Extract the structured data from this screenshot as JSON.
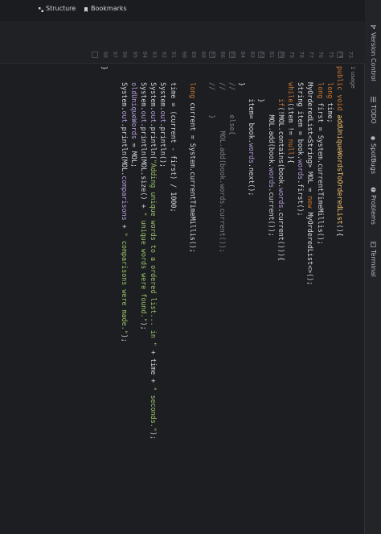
{
  "tool_windows": {
    "version_control": "Version Control",
    "todo": "TODO",
    "spotbugs": "SpotBugs",
    "problems": "Problems",
    "terminal": "Terminal"
  },
  "side_tabs": {
    "structure": "Structure",
    "bookmarks": "Bookmarks"
  },
  "gutter": {
    "line_numbers": [
      "73",
      "74",
      "75",
      "76",
      "77",
      "78",
      "79",
      "80",
      "81",
      "82",
      "83",
      "84",
      "85",
      "86",
      "87",
      "88",
      "89",
      "90",
      "91",
      "92",
      "93",
      "94",
      "95",
      "96",
      "97",
      "98"
    ]
  },
  "editor": {
    "usage_hint": "1 usage",
    "lines": [
      "public void addUniqueWordsToOrderedList(){",
      "    long time;",
      "    long first = System.currentTimeMillis();",
      "    MyOrderedList<String> MOL = new MyOrderedList<>();",
      "    String item = book.words.first();",
      "    while(item != null){",
      "        if(!MOL.contains(book.words.current())){",
      "            MOL.add(book.words.current());",
      "        }",
      "        item= book.words.next();",
      "    }",
      "    //      else{",
      "    //          MOL.add(book.words.current());",
      "    //      }",
      "",
      "    long current = System.currentTimeMillis();",
      "",
      "    time = (current - first) / 1000;",
      "    System.out.println();",
      "    System.out.println(\"Adding unique words to a ordered list... in \" + time + \" seconds.\");",
      "    System.out.println(MOL.size() + \" unique words were found.\");",
      "    oldUniqueWords = MOL;",
      "    System.out.println(MOL.comparisons + \" comparisons were made.\");",
      "",
      "}"
    ]
  },
  "colors": {
    "background": "#1c1e22",
    "keyword": "#cc7832",
    "method": "#ffc66d",
    "string": "#9bc46a",
    "field": "#b89fd8",
    "comment": "#808080"
  }
}
